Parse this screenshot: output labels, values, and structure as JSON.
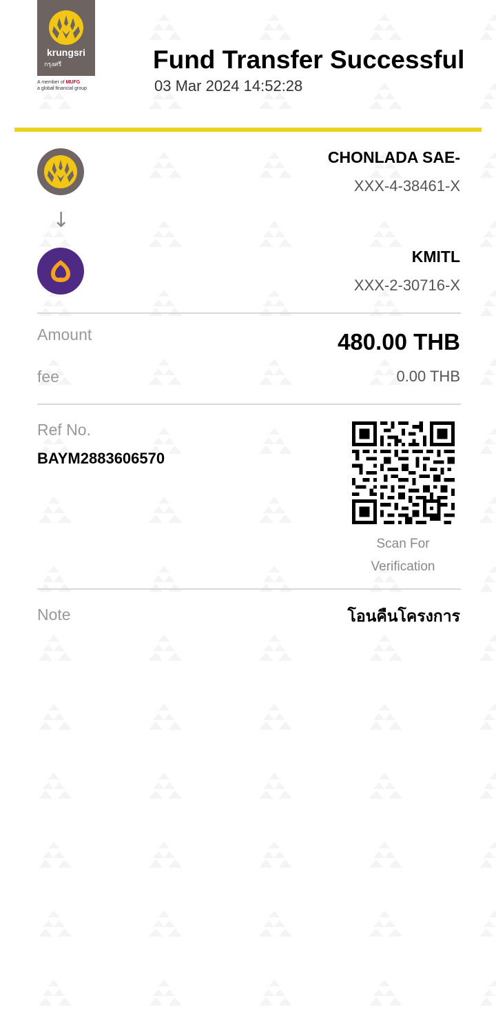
{
  "brand": {
    "name": "krungsri",
    "thai_name": "กรุงศรี",
    "member_line1_prefix": "A member of",
    "member_mufg": "MUFG",
    "member_line2": "a global financial group",
    "logo_color": "#f2c615",
    "logo_bg": "#6d6462"
  },
  "header": {
    "title": "Fund Transfer Successful",
    "datetime": "03 Mar 2024 14:52:28"
  },
  "from": {
    "name": "CHONLADA SAE-",
    "account": "XXX-4-38461-X",
    "icon": "krungsri-bank-icon"
  },
  "arrow": "↓",
  "to": {
    "name": "KMITL",
    "account": "XXX-2-30716-X",
    "icon": "scb-bank-icon"
  },
  "details": {
    "amount_label": "Amount",
    "amount_value": "480.00 THB",
    "fee_label": "fee",
    "fee_value": "0.00 THB",
    "ref_label": "Ref No.",
    "ref_value": "BAYM2883606570",
    "scan_line1": "Scan For",
    "scan_line2": "Verification",
    "note_label": "Note",
    "note_value": "โอนคืนโครงการ"
  },
  "colors": {
    "accent_yellow": "#ecd31b",
    "scb_purple": "#4e2a84",
    "scb_gold": "#f5a31a"
  }
}
